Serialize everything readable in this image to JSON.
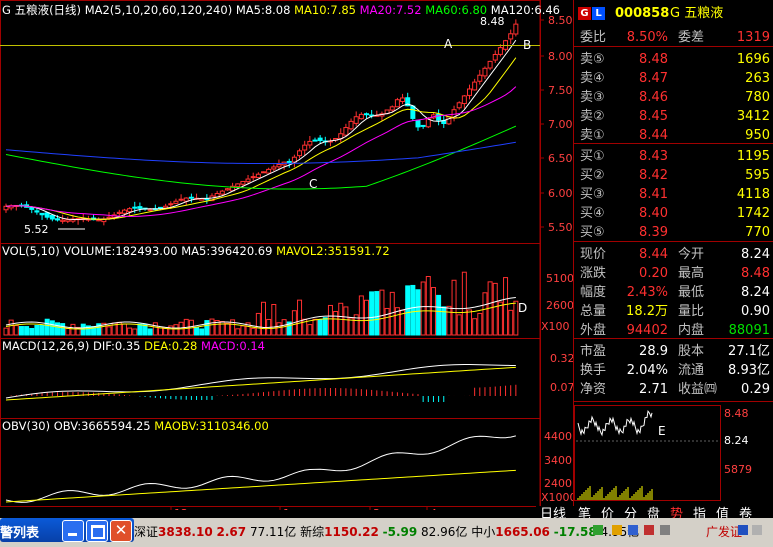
{
  "kline": {
    "title": "G 五粮液(日线)",
    "ma_label": "MA2(5,10,20,60,120,240)",
    "ma5": "MA5:8.08",
    "ma10": "MA10:7.85",
    "ma20": "MA20:7.52",
    "ma60": "MA60:6.80",
    "ma120": "MA120:6.46",
    "high_label": "8.48",
    "low_label": "5.52",
    "annot_a": "A",
    "annot_b": "B",
    "annot_c": "C",
    "yticks": [
      "8.50",
      "8.00",
      "7.50",
      "7.00",
      "6.50",
      "6.00",
      "5.50"
    ]
  },
  "volume": {
    "title": "VOL(5,10)",
    "volume": "VOLUME:182493.00",
    "ma5": "MA5:396420.69",
    "mavol2": "MAVOL2:351591.72",
    "yticks": [
      "5100",
      "2600"
    ],
    "unit": "X100",
    "annot_d": "D"
  },
  "macd": {
    "title": "MACD(12,26,9)",
    "dif": "DIF:0.35",
    "dea": "DEA:0.28",
    "macd": "MACD:0.14",
    "yticks": [
      "0.32",
      "0.07"
    ]
  },
  "obv": {
    "title": "OBV(30)",
    "obv": "OBV:3665594.25",
    "maobv": "MAOBV:3110346.00",
    "yticks": [
      "4400",
      "3400",
      "2400"
    ],
    "unit": "X1000"
  },
  "xaxis": [
    "12",
    "1",
    "3",
    "4"
  ],
  "quote": {
    "code": "000858",
    "name": "G 五粮液",
    "wb_label": "委比",
    "wb_value": "8.50%",
    "wc_label": "委差",
    "wc_value": "1319",
    "asks": [
      {
        "label": "卖⑤",
        "price": "8.48",
        "vol": "1696"
      },
      {
        "label": "卖④",
        "price": "8.47",
        "vol": "263"
      },
      {
        "label": "卖③",
        "price": "8.46",
        "vol": "780"
      },
      {
        "label": "卖②",
        "price": "8.45",
        "vol": "3412"
      },
      {
        "label": "卖①",
        "price": "8.44",
        "vol": "950"
      }
    ],
    "bids": [
      {
        "label": "买①",
        "price": "8.43",
        "vol": "1195"
      },
      {
        "label": "买②",
        "price": "8.42",
        "vol": "595"
      },
      {
        "label": "买③",
        "price": "8.41",
        "vol": "4118"
      },
      {
        "label": "买④",
        "price": "8.40",
        "vol": "1742"
      },
      {
        "label": "买⑤",
        "price": "8.39",
        "vol": "770"
      }
    ],
    "stats": [
      {
        "l1": "现价",
        "v1": "8.44",
        "l2": "今开",
        "v2": "8.24"
      },
      {
        "l1": "涨跌",
        "v1": "0.20",
        "l2": "最高",
        "v2": "8.48"
      },
      {
        "l1": "幅度",
        "v1": "2.43%",
        "l2": "最低",
        "v2": "8.24"
      },
      {
        "l1": "总量",
        "v1": "18.2万",
        "l2": "量比",
        "v2": "0.90"
      },
      {
        "l1": "外盘",
        "v1": "94402",
        "l2": "内盘",
        "v2": "88091"
      }
    ],
    "fund": [
      {
        "l1": "市盈",
        "v1": "28.9",
        "l2": "股本",
        "v2": "27.1亿"
      },
      {
        "l1": "换手",
        "v1": "2.04%",
        "l2": "流通",
        "v2": "8.93亿"
      },
      {
        "l1": "净资",
        "v1": "2.71",
        "l2": "收益㈣",
        "v2": "0.29"
      }
    ],
    "mini": {
      "high": "8.48",
      "mid": "8.24",
      "vol": "5879",
      "annot": "E"
    }
  },
  "tabs": [
    "日线",
    "笔",
    "价",
    "分",
    "盘",
    "势",
    "指",
    "值",
    "卷"
  ],
  "taskbar": {
    "window_title": "警列表",
    "ticker": [
      {
        "name": "深证",
        "val": "3838.10",
        "chg": "2.67",
        "amt": "77.11亿"
      },
      {
        "name": "新综",
        "val": "1150.22",
        "chg": "-5.99",
        "amt": "82.96亿"
      },
      {
        "name": "中小",
        "val": "1665.06",
        "chg": "-17.58",
        "amt": "4.95亿"
      }
    ],
    "company": "广发证"
  },
  "colors": {
    "red": "#ff3030",
    "cyan": "#00ffff",
    "yellow": "#ffff00",
    "magenta": "#ff00ff",
    "green": "#00ff00",
    "blue": "#2040ff"
  }
}
